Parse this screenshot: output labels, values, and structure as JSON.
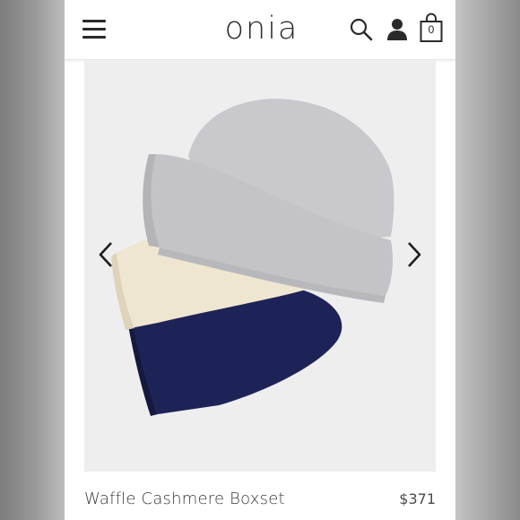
{
  "header": {
    "logo": "onia",
    "cart_count": "0",
    "icons": [
      "menu-icon",
      "search-icon",
      "user-icon",
      "shopping-bag-icon"
    ]
  },
  "carousel": {
    "image_description_colors": {
      "backdrop": "#efefef",
      "grey_beanie": "#c9c9cd",
      "cream_beanie": "#efe6d2",
      "navy_beanie": "#1e2357"
    },
    "prev_icon": "chevron-left-icon",
    "next_icon": "chevron-right-icon"
  },
  "product": {
    "name": "Waffle Cashmere Boxset",
    "price": "$371"
  }
}
